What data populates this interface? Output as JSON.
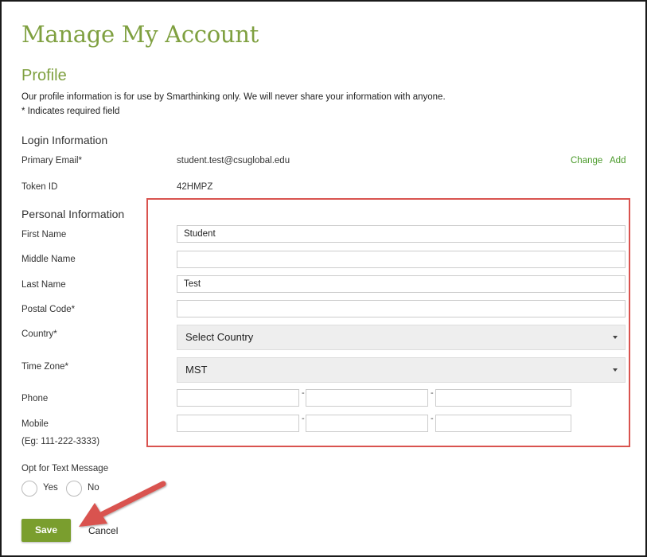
{
  "page": {
    "title": "Manage My Account",
    "subtitle": "Profile",
    "intro": "Our profile information is for use by Smarthinking only. We will never share your information with anyone.",
    "required_note": "* Indicates required field"
  },
  "login": {
    "heading": "Login Information",
    "email_label": "Primary Email*",
    "email_value": "student.test@csuglobal.edu",
    "change_link": "Change",
    "add_link": "Add",
    "token_label": "Token ID",
    "token_value": "42HMPZ"
  },
  "personal": {
    "heading": "Personal Information",
    "first_name_label": "First Name",
    "first_name_value": "Student",
    "middle_name_label": "Middle Name",
    "middle_name_value": "",
    "last_name_label": "Last Name",
    "last_name_value": "Test",
    "postal_label": "Postal Code*",
    "postal_value": "",
    "country_label": "Country*",
    "country_value": "Select Country",
    "timezone_label": "Time Zone*",
    "timezone_value": "MST",
    "phone_label": "Phone",
    "mobile_label": "Mobile",
    "mobile_example": "(Eg: 111-222-3333)",
    "dash": "-"
  },
  "text_opt": {
    "label": "Opt for Text Message",
    "yes": "Yes",
    "no": "No"
  },
  "actions": {
    "save": "Save",
    "cancel": "Cancel"
  },
  "colors": {
    "brand_green": "#7fa040",
    "button_green": "#7a9e2e",
    "link_green": "#4a9a2a",
    "annotation_red": "#d9534f"
  }
}
